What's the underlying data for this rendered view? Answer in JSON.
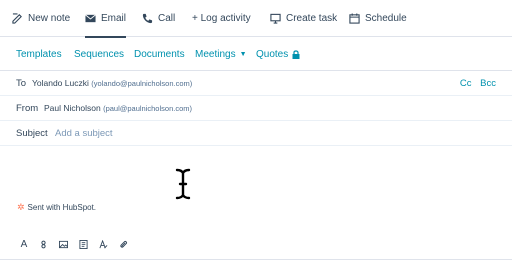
{
  "activity_tabs": [
    {
      "label": "New note",
      "icon": "pencil-icon",
      "active": false
    },
    {
      "label": "Email",
      "icon": "envelope-icon",
      "active": true
    },
    {
      "label": "Call",
      "icon": "phone-icon",
      "active": false
    },
    {
      "label": "+ Log activity",
      "icon": "",
      "active": false
    },
    {
      "label": "Create task",
      "icon": "monitor-icon",
      "active": false
    },
    {
      "label": "Schedule",
      "icon": "calendar-icon",
      "active": false
    }
  ],
  "toolbar": {
    "templates": "Templates",
    "sequences": "Sequences",
    "documents": "Documents",
    "meetings": "Meetings",
    "quotes": "Quotes"
  },
  "to": {
    "label": "To",
    "name": "Yolando Luczki",
    "email": "(yolando@paulnicholson.com)",
    "cc": "Cc",
    "bcc": "Bcc"
  },
  "from": {
    "label": "From",
    "name": "Paul Nicholson",
    "email": "(paul@paulnicholson.com)"
  },
  "subject": {
    "label": "Subject",
    "placeholder": "Add a subject"
  },
  "signature": {
    "text": "Sent with HubSpot."
  },
  "format_toolbar": {
    "font_glyph": "A"
  },
  "colors": {
    "link": "#0091ae",
    "text": "#33475b",
    "muted": "#7c98b6",
    "border": "#dfe3eb",
    "hubspot_orange": "#ff7a59"
  }
}
